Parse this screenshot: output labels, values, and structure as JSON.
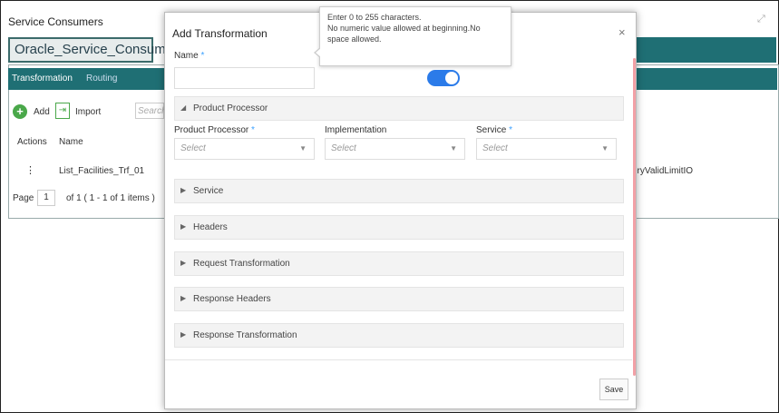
{
  "background": {
    "window_title": "Service Consumers",
    "consumer_name": "Oracle_Service_Consumer",
    "tabs": [
      {
        "label": "Transformation"
      },
      {
        "label": "Routing"
      }
    ],
    "toolbar": {
      "add_label": "Add",
      "import_label": "Import",
      "search_placeholder": "Search"
    },
    "table": {
      "headers": [
        "Actions",
        "Name"
      ],
      "rows": [
        {
          "actions": "⋮",
          "name": "List_Facilities_Trf_01",
          "extra": "eryValidLimitIO"
        }
      ]
    },
    "pagination": {
      "page_label": "Page",
      "page_value": "1",
      "info": "of 1   ( 1 - 1 of 1 items )"
    }
  },
  "modal": {
    "title": "Add Transformation",
    "close_glyph": "×",
    "name_label": "Name",
    "required_mark": "*",
    "name_value": "",
    "toggle_on": true,
    "product_processor_section": "Product Processor",
    "fields": {
      "product_processor": {
        "label": "Product Processor",
        "value": "Select"
      },
      "implementation": {
        "label": "Implementation",
        "value": "Select"
      },
      "service": {
        "label": "Service",
        "value": "Select"
      }
    },
    "sections": [
      {
        "label": "Service"
      },
      {
        "label": "Headers"
      },
      {
        "label": "Request Transformation"
      },
      {
        "label": "Response Headers"
      },
      {
        "label": "Response Transformation"
      }
    ],
    "save_label": "Save"
  },
  "tooltip": {
    "line1": "Enter 0 to 255 characters.",
    "line2": "No numeric value allowed at beginning.No space allowed."
  },
  "colors": {
    "accent_teal": "#1f6f74",
    "toggle_blue": "#2b7be9",
    "required_blue": "#3aa0ff",
    "add_green": "#4aa84a",
    "scrollbar_pink": "#f2a0a6"
  }
}
